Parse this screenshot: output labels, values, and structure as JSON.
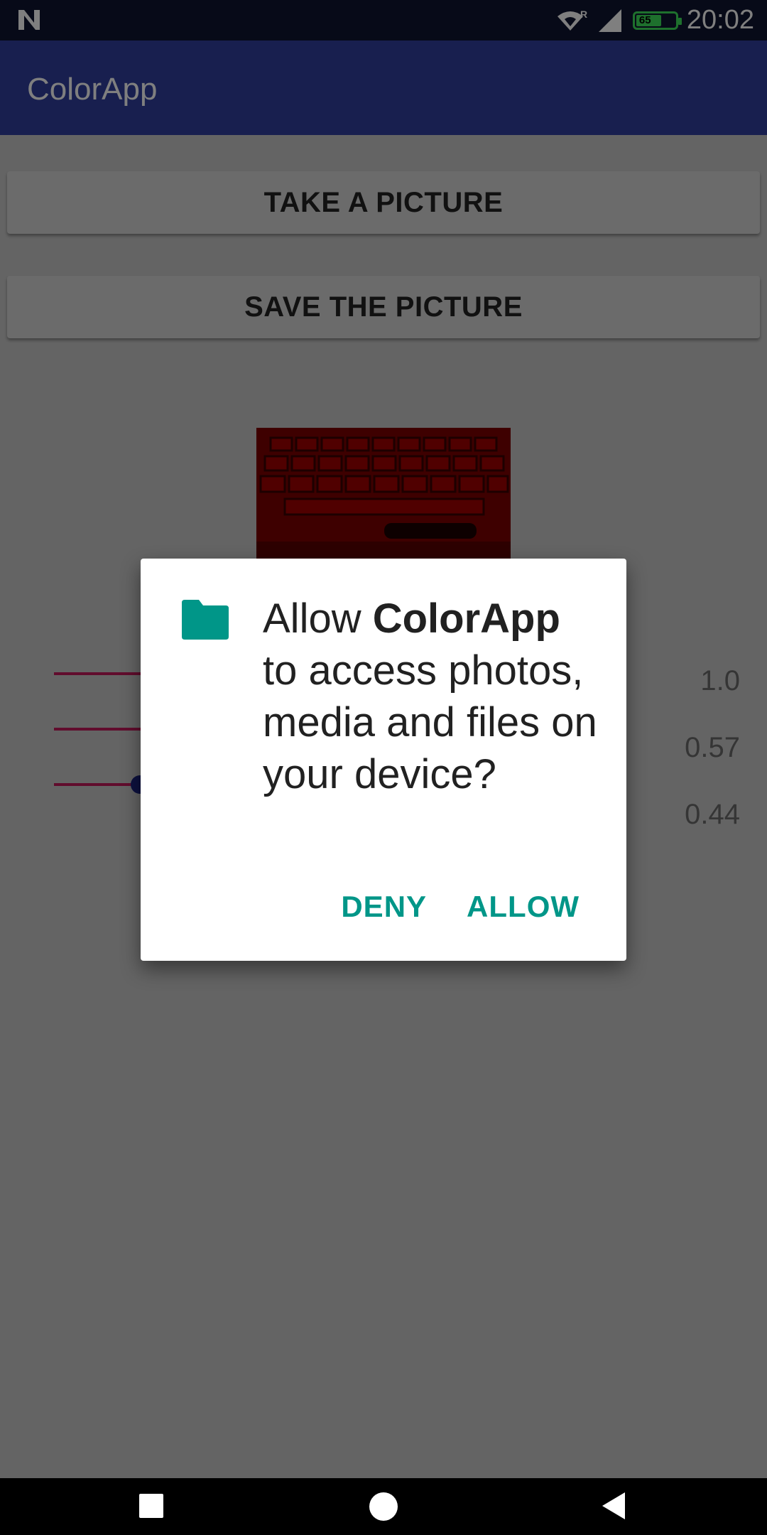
{
  "status_bar": {
    "time": "20:02",
    "battery_level": "65",
    "roaming_indicator": "R",
    "icons": [
      "n-icon",
      "wifi-icon",
      "signal-icon",
      "battery-icon"
    ]
  },
  "app_bar": {
    "title": "ColorApp"
  },
  "buttons": {
    "take_picture": "TAKE A PICTURE",
    "save_picture": "SAVE THE PICTURE"
  },
  "sliders": [
    {
      "value_label": "1.0",
      "value": 1.0
    },
    {
      "value_label": "0.57",
      "value": 0.57
    },
    {
      "value_label": "0.44",
      "value": 0.44
    }
  ],
  "dialog": {
    "icon": "folder-icon",
    "message_prefix": "Allow ",
    "app_name": "ColorApp",
    "message_suffix": " to access photos, media and files on your device?",
    "deny_label": "DENY",
    "allow_label": "ALLOW"
  },
  "colors": {
    "app_bar": "#303f9f",
    "status_bar": "#0f1430",
    "accent": "#009688",
    "slider_track": "#c2185b",
    "slider_thumb": "#1a237e"
  }
}
